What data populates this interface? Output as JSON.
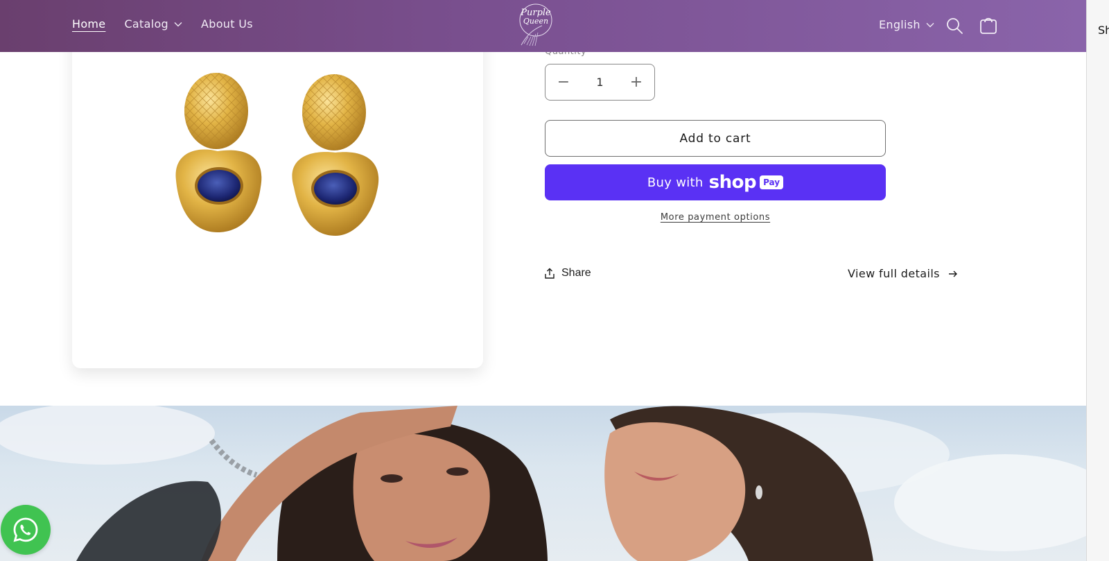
{
  "header": {
    "nav": [
      {
        "label": "Home",
        "active": true
      },
      {
        "label": "Catalog",
        "has_dropdown": true
      },
      {
        "label": "About Us"
      }
    ],
    "logo_text_line1": "Purple",
    "logo_text_line2": "Queen",
    "language": "English",
    "icons": [
      "search-icon",
      "cart-icon",
      "chevron-down-icon"
    ]
  },
  "product": {
    "quantity_label": "Quantity",
    "quantity_value": "1",
    "decrement_glyph": "−",
    "increment_glyph": "+",
    "add_to_cart": "Add to cart",
    "buy_with": "Buy with",
    "shop_word": "shop",
    "pay_badge": "Pay",
    "more_payment_options": "More payment options",
    "share": "Share",
    "view_full_details": "View full details"
  },
  "scrollbar_peek_text": "Sh",
  "colors": {
    "header_start": "#6a3f6e",
    "header_end": "#8a64aa",
    "shop_pay": "#5a31f4",
    "whatsapp": "#40c351"
  }
}
